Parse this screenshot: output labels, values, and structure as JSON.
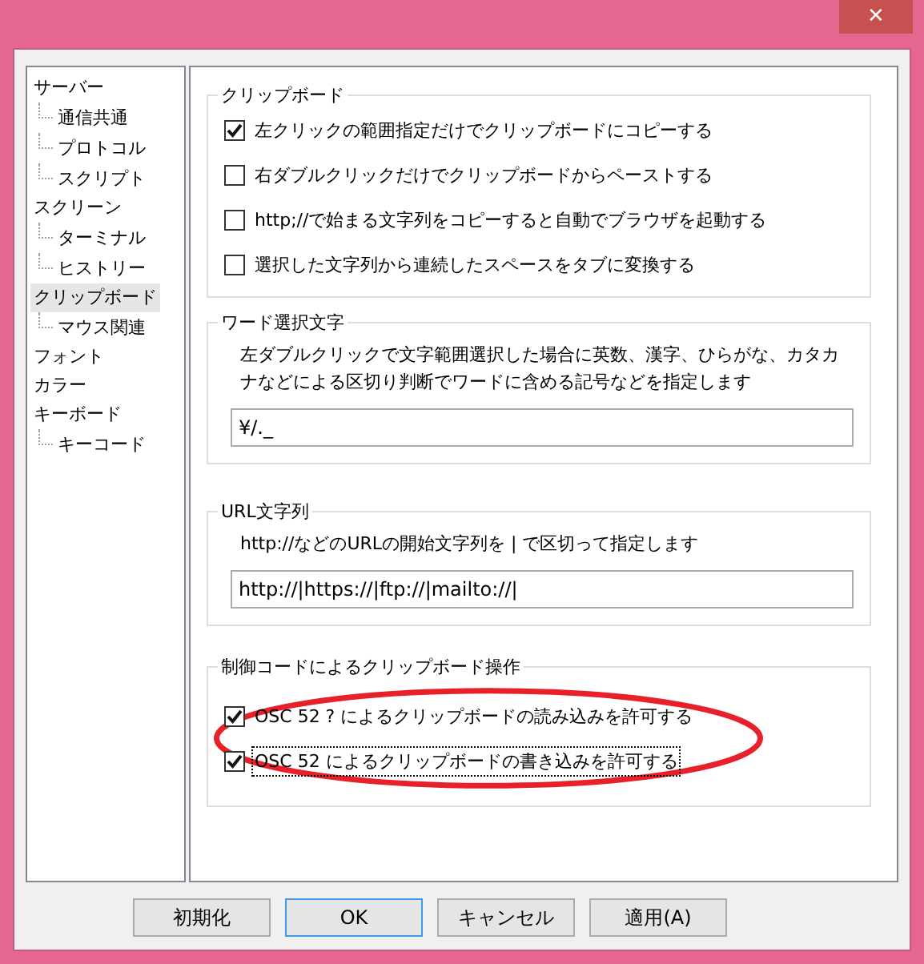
{
  "window": {
    "close_button": "✕"
  },
  "tree": [
    {
      "label": "サーバー",
      "selected": false,
      "children": [
        {
          "label": "通信共通",
          "selected": false
        },
        {
          "label": "プロトコル",
          "selected": false
        },
        {
          "label": "スクリプト",
          "selected": false
        }
      ]
    },
    {
      "label": "スクリーン",
      "selected": false,
      "children": [
        {
          "label": "ターミナル",
          "selected": false
        },
        {
          "label": "ヒストリー",
          "selected": false
        }
      ]
    },
    {
      "label": "クリップボード",
      "selected": true,
      "children": [
        {
          "label": "マウス関連",
          "selected": false
        }
      ]
    },
    {
      "label": "フォント",
      "selected": false
    },
    {
      "label": "カラー",
      "selected": false
    },
    {
      "label": "キーボード",
      "selected": false,
      "children": [
        {
          "label": "キーコード",
          "selected": false
        }
      ]
    }
  ],
  "groups": [
    {
      "title": "クリップボード",
      "highlighted": false,
      "items": [
        {
          "kind": "checkbox",
          "label": "左クリックの範囲指定だけでクリップボードにコピーする",
          "checked": true,
          "focused": false
        },
        {
          "kind": "checkbox",
          "label": "右ダブルクリックだけでクリップボードからペーストする",
          "checked": false,
          "focused": false
        },
        {
          "kind": "checkbox",
          "label": "http;//で始まる文字列をコピーすると自動でブラウザを起動する",
          "checked": false,
          "focused": false
        },
        {
          "kind": "checkbox",
          "label": "選択した文字列から連続したスペースをタブに変換する",
          "checked": false,
          "focused": false
        }
      ]
    },
    {
      "title": "ワード選択文字",
      "highlighted": false,
      "items": [
        {
          "kind": "description",
          "text": "左ダブルクリックで文字範囲選択した場合に英数、漢字、ひらがな、カタカナなどによる区切り判断でワードに含める記号などを指定します"
        },
        {
          "kind": "field",
          "value": "¥/._"
        }
      ]
    },
    {
      "title": "URL文字列",
      "highlighted": false,
      "items": [
        {
          "kind": "description",
          "text": "http://などのURLの開始文字列を | で区切って指定します"
        },
        {
          "kind": "field",
          "value": "http://|https://|ftp://|mailto://|"
        }
      ]
    },
    {
      "title": "制御コードによるクリップボード操作",
      "highlighted": true,
      "items": [
        {
          "kind": "checkbox",
          "label": "OSC 52 ? によるクリップボードの読み込みを許可する",
          "checked": true,
          "focused": false
        },
        {
          "kind": "checkbox",
          "label": "OSC 52 によるクリップボードの書き込みを許可する",
          "checked": true,
          "focused": true
        }
      ]
    }
  ],
  "buttons": [
    {
      "label": "初期化",
      "default": false
    },
    {
      "label": "OK",
      "default": true
    },
    {
      "label": "キャンセル",
      "default": false
    },
    {
      "label": "適用(A)",
      "default": false
    }
  ]
}
